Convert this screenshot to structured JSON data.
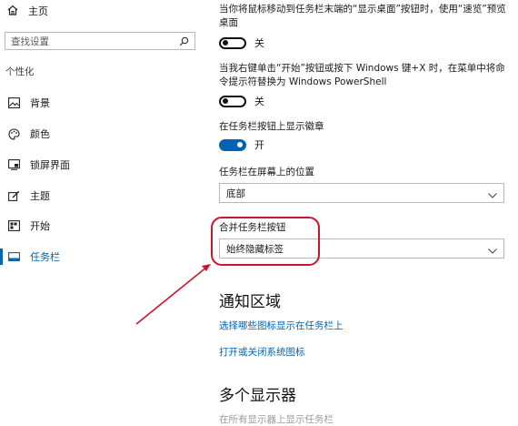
{
  "sidebar": {
    "home_label": "主页",
    "search_placeholder": "查找设置",
    "section_label": "个性化",
    "items": [
      {
        "label": "背景",
        "icon": "image-icon"
      },
      {
        "label": "颜色",
        "icon": "palette-icon"
      },
      {
        "label": "锁屏界面",
        "icon": "lock-screen-icon"
      },
      {
        "label": "主题",
        "icon": "brush-icon"
      },
      {
        "label": "开始",
        "icon": "start-icon"
      },
      {
        "label": "任务栏",
        "icon": "taskbar-icon",
        "active": true
      }
    ]
  },
  "main": {
    "peek_desc": "当你将鼠标移动到任务栏末端的“显示桌面”按钮时，使用“速览”预览桌面",
    "peek_state": "关",
    "powershell_desc": "当我右键单击“开始”按钮或按下 Windows 键+X 时，在菜单中将命令提示符替换为 Windows PowerShell",
    "powershell_state": "关",
    "badges_label": "在任务栏按钮上显示徽章",
    "badges_state": "开",
    "position_label": "任务栏在屏幕上的位置",
    "position_value": "底部",
    "combine_label": "合并任务栏按钮",
    "combine_value": "始终隐藏标签",
    "notif_heading": "通知区域",
    "notif_link1": "选择哪些图标显示在任务栏上",
    "notif_link2": "打开或关闭系统图标",
    "multi_heading": "多个显示器",
    "multi_desc": "在所有显示器上显示任务栏"
  },
  "colors": {
    "accent": "#0063b1",
    "annotation": "#c8162b"
  }
}
